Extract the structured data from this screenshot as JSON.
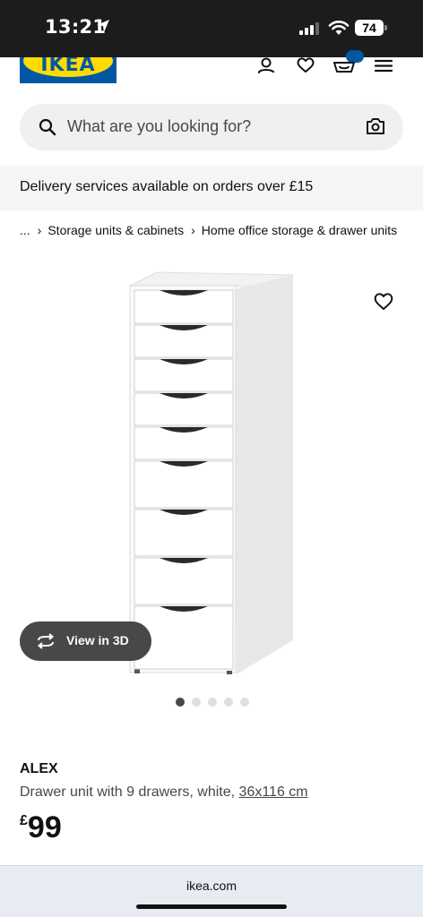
{
  "status_bar": {
    "time": "13:21",
    "battery": "74"
  },
  "header": {
    "logo_text": "IKEA",
    "icons": [
      "user-icon",
      "heart-icon",
      "basket-icon",
      "menu-icon"
    ]
  },
  "search": {
    "placeholder": "What are you looking for?"
  },
  "banner": {
    "text": "Delivery services available on orders over £15"
  },
  "breadcrumb": {
    "ellipsis": "...",
    "items": [
      "Storage units & cabinets",
      "Home office storage & drawer units"
    ]
  },
  "gallery": {
    "view_3d_label": "View in 3D",
    "image_count": 5,
    "active_index": 0
  },
  "product": {
    "name": "ALEX",
    "description": "Drawer unit with 9 drawers, white,",
    "dimensions": "36x116 cm",
    "currency": "£",
    "price": "99"
  },
  "footer": {
    "domain": "ikea.com"
  },
  "colors": {
    "ikea_blue": "#0058a3",
    "ikea_yellow": "#ffdb00",
    "status_bar": "#1c1c1c"
  }
}
